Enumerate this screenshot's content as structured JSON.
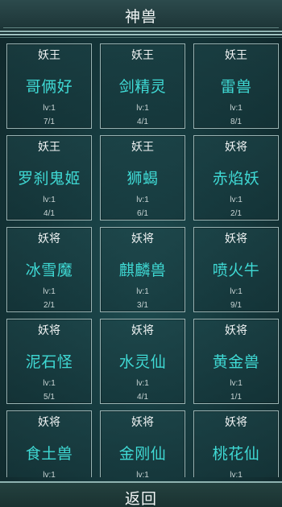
{
  "header": {
    "title": "神兽"
  },
  "footer": {
    "back_label": "返回"
  },
  "cards": [
    {
      "rank": "妖王",
      "name": "哥俩好",
      "level": "lv:1",
      "count": "7/1"
    },
    {
      "rank": "妖王",
      "name": "剑精灵",
      "level": "lv:1",
      "count": "4/1"
    },
    {
      "rank": "妖王",
      "name": "雷兽",
      "level": "lv:1",
      "count": "8/1"
    },
    {
      "rank": "妖王",
      "name": "罗刹鬼姬",
      "level": "lv:1",
      "count": "4/1"
    },
    {
      "rank": "妖王",
      "name": "狮蝎",
      "level": "lv:1",
      "count": "6/1"
    },
    {
      "rank": "妖将",
      "name": "赤焰妖",
      "level": "lv:1",
      "count": "2/1"
    },
    {
      "rank": "妖将",
      "name": "冰雪魔",
      "level": "lv:1",
      "count": "2/1"
    },
    {
      "rank": "妖将",
      "name": "麒麟兽",
      "level": "lv:1",
      "count": "3/1"
    },
    {
      "rank": "妖将",
      "name": "喷火牛",
      "level": "lv:1",
      "count": "9/1"
    },
    {
      "rank": "妖将",
      "name": "泥石怪",
      "level": "lv:1",
      "count": "5/1"
    },
    {
      "rank": "妖将",
      "name": "水灵仙",
      "level": "lv:1",
      "count": "4/1"
    },
    {
      "rank": "妖将",
      "name": "黄金兽",
      "level": "lv:1",
      "count": "1/1"
    },
    {
      "rank": "妖将",
      "name": "食土兽",
      "level": "lv:1",
      "count": ""
    },
    {
      "rank": "妖将",
      "name": "金刚仙",
      "level": "lv:1",
      "count": ""
    },
    {
      "rank": "妖将",
      "name": "桃花仙",
      "level": "lv:1",
      "count": ""
    }
  ],
  "colors": {
    "name_accent": "#3fd9d4",
    "border": "#9ab4b4",
    "background": "#163a3e"
  }
}
